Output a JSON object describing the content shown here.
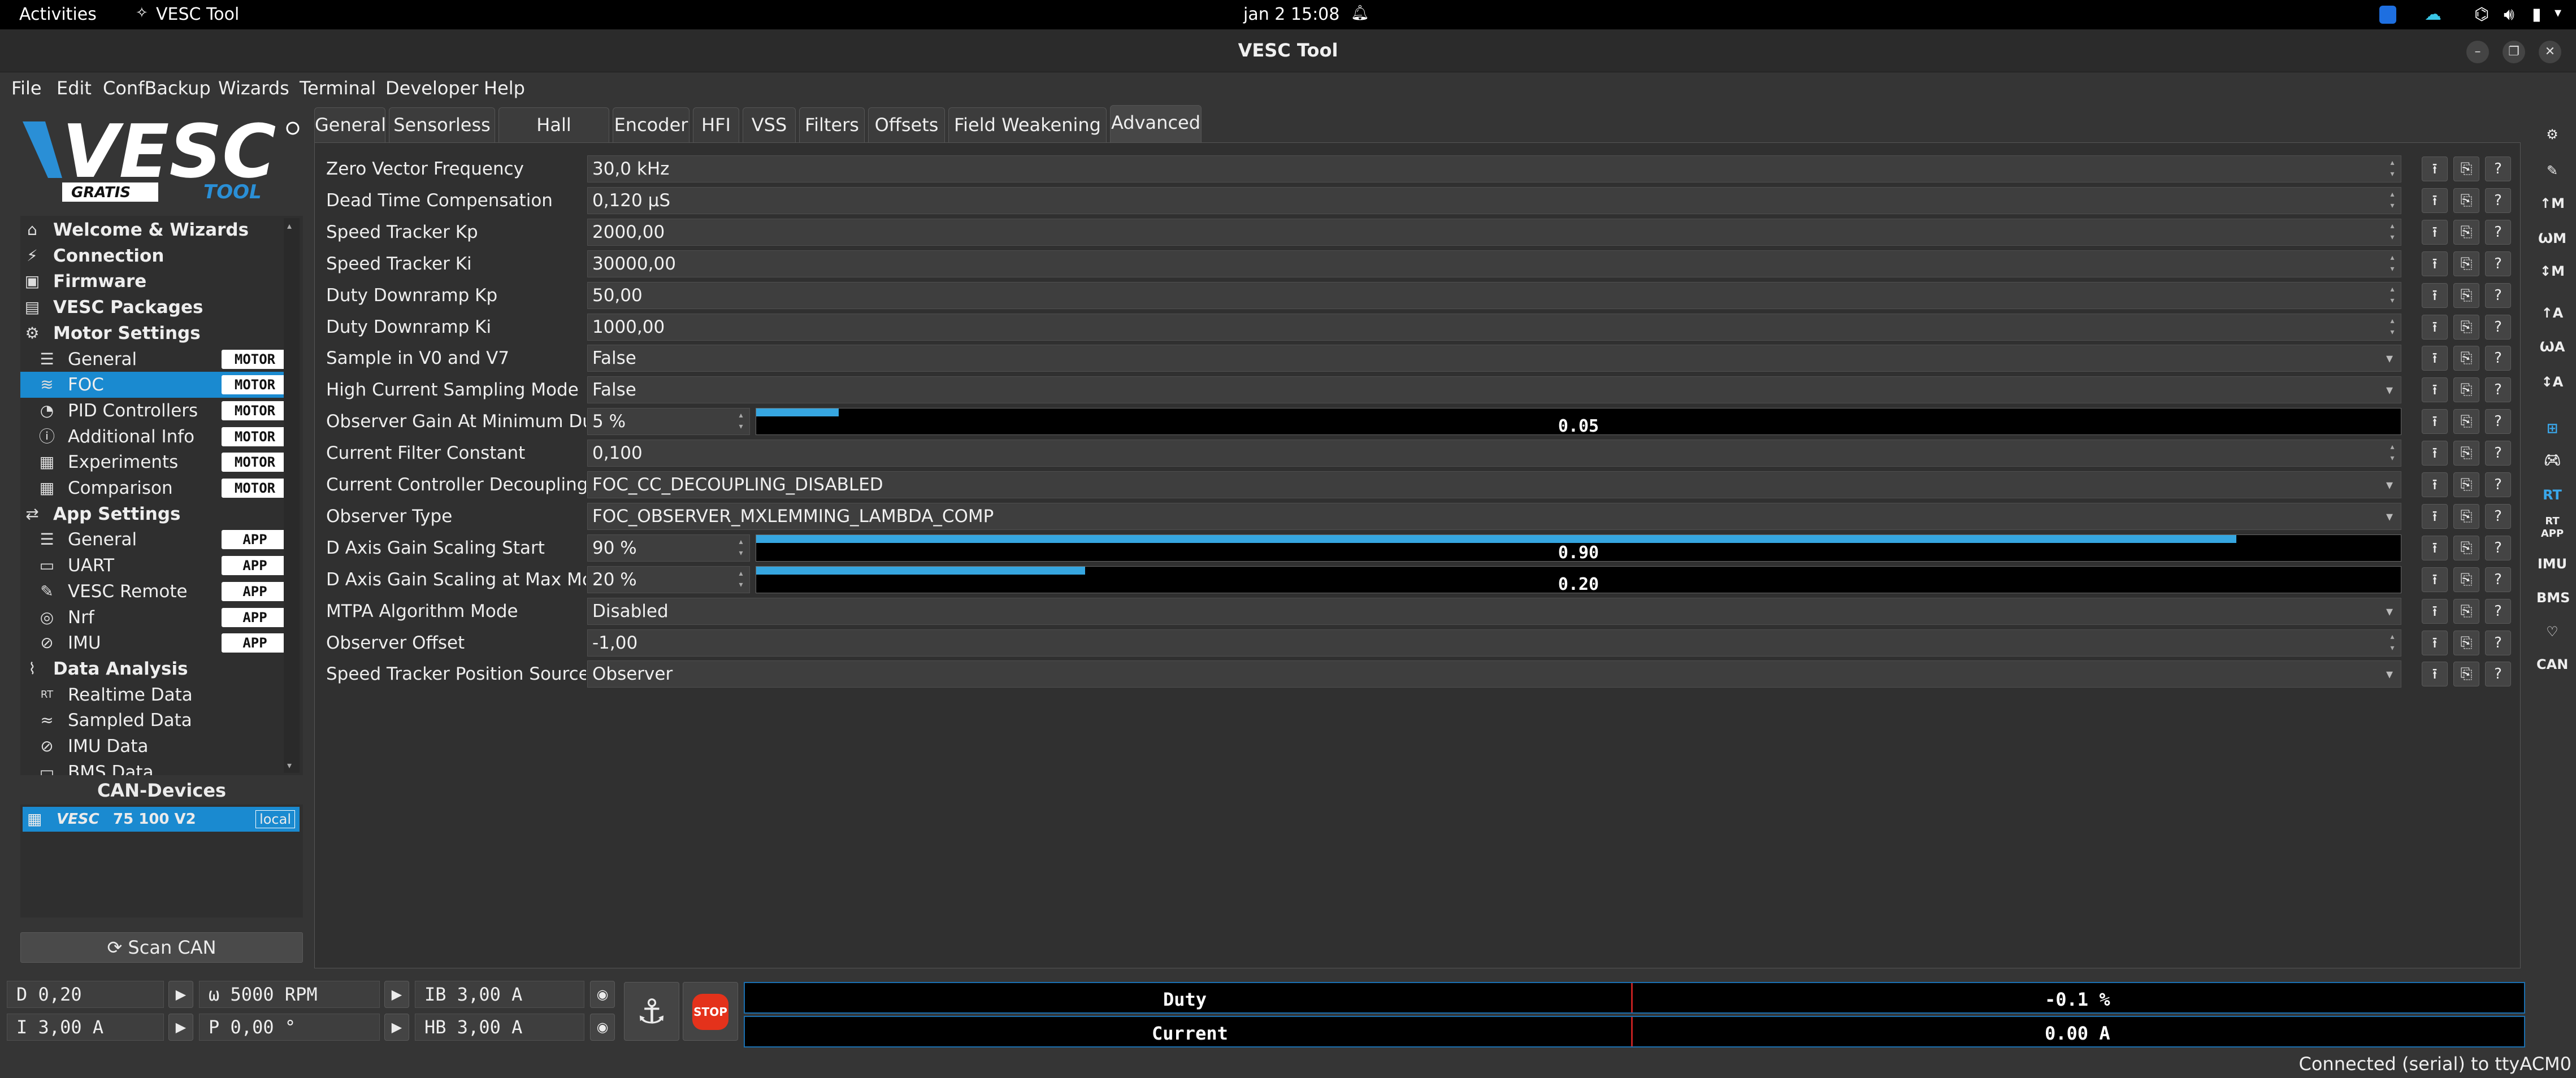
{
  "system_bar": {
    "activities": "Activities",
    "app_name": "VESC Tool",
    "datetime": "jan 2  15:08"
  },
  "window": {
    "title": "VESC Tool"
  },
  "menu": [
    "File",
    "Edit",
    "ConfBackup",
    "Wizards",
    "Terminal",
    "Developer",
    "Help"
  ],
  "logo": {
    "text": "VESC",
    "sub1": "GRATIS",
    "sub2": "TOOL"
  },
  "sidebar": {
    "items": [
      {
        "label": "Welcome & Wizards",
        "icon": "home-icon",
        "bold": true,
        "indent": 0
      },
      {
        "label": "Connection",
        "icon": "plug-icon",
        "bold": true,
        "indent": 0
      },
      {
        "label": "Firmware",
        "icon": "chip-icon",
        "bold": true,
        "indent": 0
      },
      {
        "label": "VESC Packages",
        "icon": "package-icon",
        "bold": true,
        "indent": 0
      },
      {
        "label": "Motor Settings",
        "icon": "motor-icon",
        "bold": true,
        "indent": 0
      },
      {
        "label": "General",
        "icon": "sliders-icon",
        "badge": "MOTOR",
        "indent": 1
      },
      {
        "label": "FOC",
        "icon": "foc-icon",
        "badge": "MOTOR",
        "indent": 1,
        "selected": true
      },
      {
        "label": "PID Controllers",
        "icon": "gauge-icon",
        "badge": "MOTOR",
        "indent": 1
      },
      {
        "label": "Additional Info",
        "icon": "info-icon",
        "badge": "MOTOR",
        "indent": 1
      },
      {
        "label": "Experiments",
        "icon": "calculator-icon",
        "badge": "MOTOR",
        "indent": 1
      },
      {
        "label": "Comparison",
        "icon": "calculator-icon",
        "badge": "MOTOR",
        "indent": 1
      },
      {
        "label": "App Settings",
        "icon": "app-settings-icon",
        "bold": true,
        "indent": 0
      },
      {
        "label": "General",
        "icon": "sliders-icon",
        "badge": "APP",
        "indent": 1
      },
      {
        "label": "UART",
        "icon": "uart-icon",
        "badge": "APP",
        "indent": 1
      },
      {
        "label": "VESC Remote",
        "icon": "remote-icon",
        "badge": "APP",
        "indent": 1
      },
      {
        "label": "Nrf",
        "icon": "wireless-icon",
        "badge": "APP",
        "indent": 1
      },
      {
        "label": "IMU",
        "icon": "imu-icon",
        "badge": "APP",
        "indent": 1
      },
      {
        "label": "Data Analysis",
        "icon": "analysis-icon",
        "bold": true,
        "indent": 0
      },
      {
        "label": "Realtime Data",
        "icon": "rt-icon",
        "indent": 1
      },
      {
        "label": "Sampled Data",
        "icon": "sampled-icon",
        "indent": 1
      },
      {
        "label": "IMU Data",
        "icon": "imu-icon",
        "indent": 1
      },
      {
        "label": "BMS Data",
        "icon": "bms-icon",
        "indent": 1
      }
    ],
    "can_label": "CAN-Devices",
    "can_device": {
      "name": "75 100 V2",
      "badge": "local"
    },
    "scan_button": "Scan CAN"
  },
  "tabs": [
    {
      "label": "General"
    },
    {
      "label": "Sensorless"
    },
    {
      "label": "Hall Sensors"
    },
    {
      "label": "Encoder"
    },
    {
      "label": "HFI"
    },
    {
      "label": "VSS"
    },
    {
      "label": "Filters"
    },
    {
      "label": "Offsets"
    },
    {
      "label": "Field Weakening"
    },
    {
      "label": "Advanced",
      "active": true
    }
  ],
  "params": [
    {
      "label": "Zero Vector Frequency",
      "value": "30,0 kHz",
      "kind": "spin"
    },
    {
      "label": "Dead Time Compensation",
      "value": "0,120 µS",
      "kind": "spin"
    },
    {
      "label": "Speed Tracker Kp",
      "value": "2000,00",
      "kind": "spin"
    },
    {
      "label": "Speed Tracker Ki",
      "value": "30000,00",
      "kind": "spin"
    },
    {
      "label": "Duty Downramp Kp",
      "value": "50,00",
      "kind": "spin"
    },
    {
      "label": "Duty Downramp Ki",
      "value": "1000,00",
      "kind": "spin"
    },
    {
      "label": "Sample in V0 and V7",
      "value": "False",
      "kind": "combo"
    },
    {
      "label": "High Current Sampling Mode",
      "value": "False",
      "kind": "combo"
    },
    {
      "label": "Observer Gain At Minimum Duty",
      "value": "5 %",
      "kind": "bar",
      "bar_text": "0.05",
      "fraction": 0.05
    },
    {
      "label": "Current Filter Constant",
      "value": "0,100",
      "kind": "spin"
    },
    {
      "label": "Current Controller Decoupling",
      "value": "FOC_CC_DECOUPLING_DISABLED",
      "kind": "combo"
    },
    {
      "label": "Observer Type",
      "value": "FOC_OBSERVER_MXLEMMING_LAMBDA_COMP",
      "kind": "combo"
    },
    {
      "label": "D Axis Gain Scaling Start",
      "value": "90 %",
      "kind": "bar",
      "bar_text": "0.90",
      "fraction": 0.9
    },
    {
      "label": "D Axis Gain Scaling at Max Mod",
      "value": "20 %",
      "kind": "bar",
      "bar_text": "0.20",
      "fraction": 0.2
    },
    {
      "label": "MTPA Algorithm Mode",
      "value": "Disabled",
      "kind": "combo"
    },
    {
      "label": "Observer Offset",
      "value": "-1,00",
      "kind": "spin"
    },
    {
      "label": "Speed Tracker Position Source",
      "value": "Observer",
      "kind": "combo"
    }
  ],
  "right_toolbar": [
    "",
    "",
    "↑M",
    "ѠM",
    "↕M",
    "↑A",
    "ѠA",
    "↕A",
    "",
    "",
    "RT",
    "RT APP",
    "IMU",
    "BMS",
    "♡",
    "CAN"
  ],
  "bottom": {
    "duty_field": "D 0,20",
    "rpm_field": "ω 5000 RPM",
    "ib_field": "IB 3,00 A",
    "current_field": "I 3,00 A",
    "pos_field": "P 0,00 °",
    "hb_field": "HB 3,00 A",
    "stop_label": "STOP",
    "duty_gauge": {
      "label": "Duty",
      "value": "-0.1 %"
    },
    "current_gauge": {
      "label": "Current",
      "value": "0.00 A"
    }
  },
  "status_text": "Connected (serial) to ttyACM0"
}
